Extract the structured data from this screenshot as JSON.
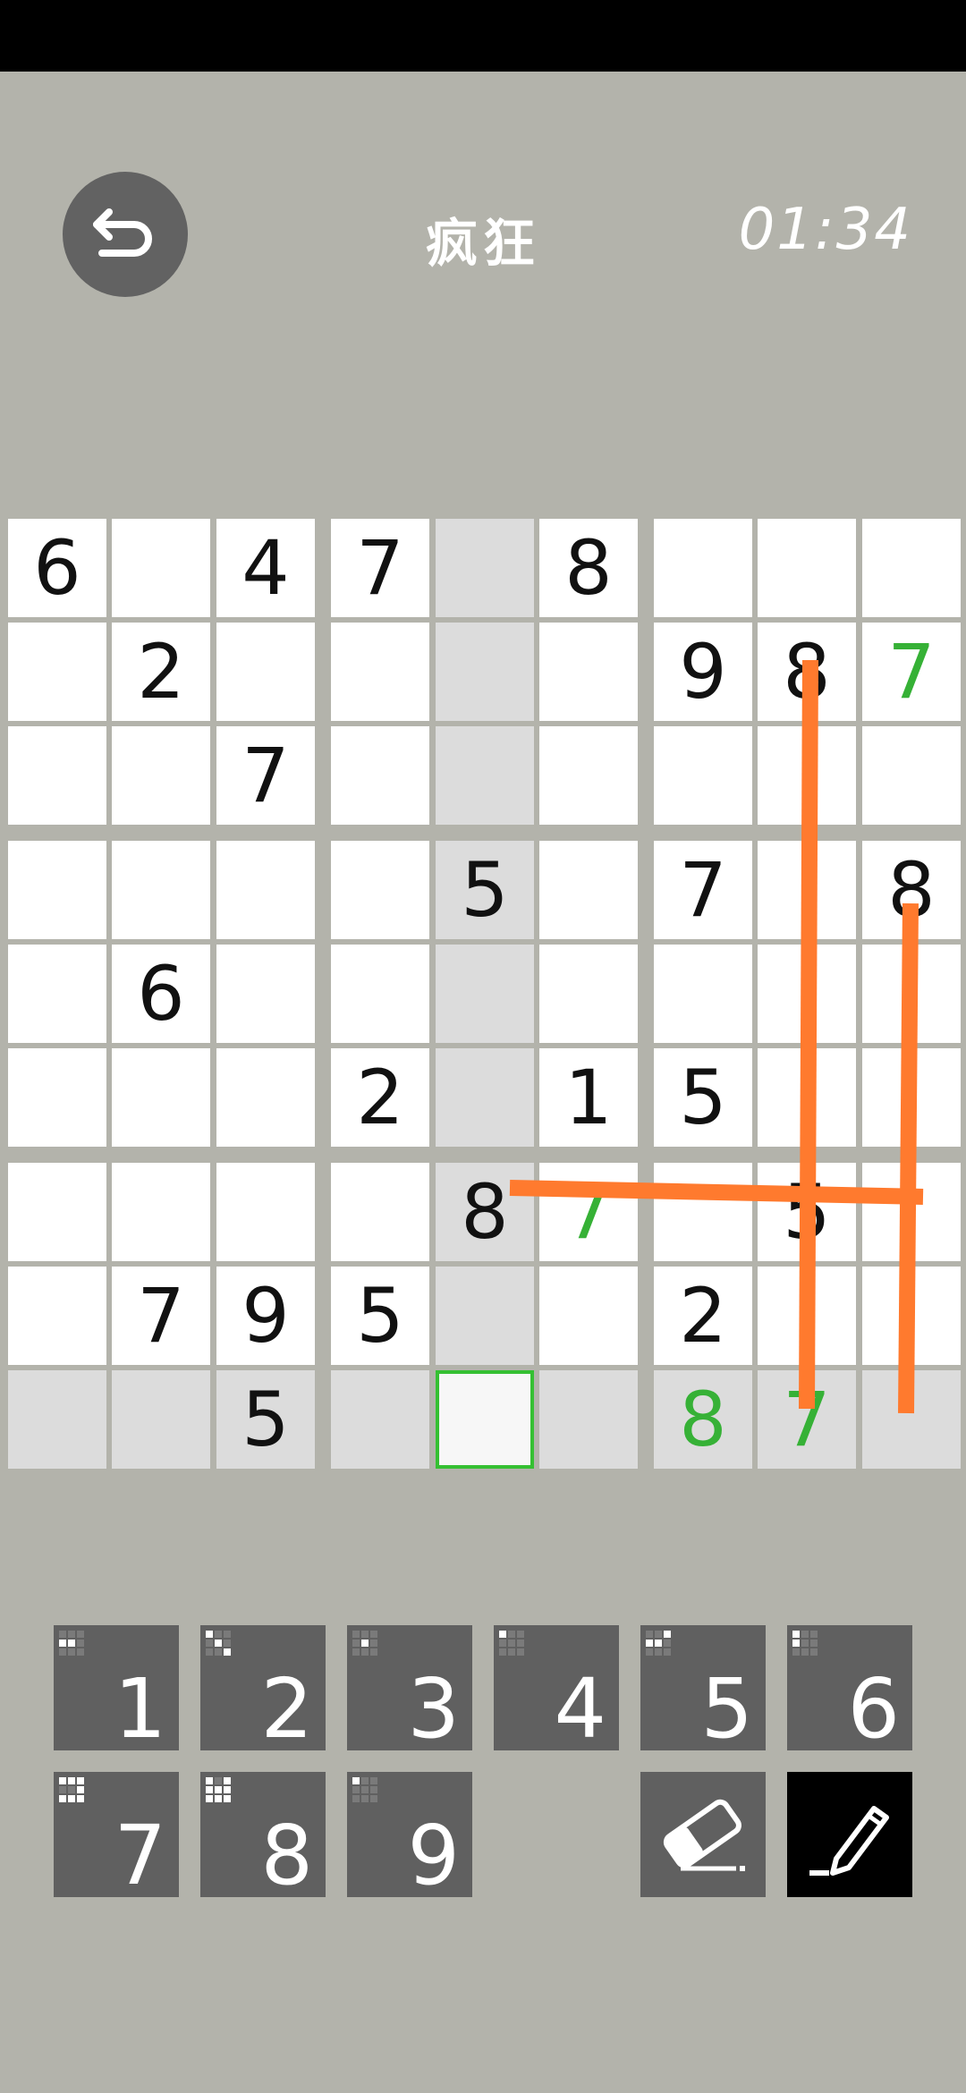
{
  "header": {
    "title": "疯狂",
    "timer": "01:34",
    "back_icon": "undo-arrow-icon"
  },
  "board": {
    "givens": [
      [
        "6",
        "",
        "4",
        "7",
        "",
        "8",
        "",
        "",
        ""
      ],
      [
        "",
        "2",
        "",
        "",
        "",
        "",
        "9",
        "8",
        ""
      ],
      [
        "",
        "",
        "7",
        "",
        "",
        "",
        "",
        "",
        ""
      ],
      [
        "",
        "",
        "",
        "",
        "5",
        "",
        "7",
        "",
        "8"
      ],
      [
        "",
        "6",
        "",
        "",
        "",
        "",
        "",
        "",
        ""
      ],
      [
        "",
        "",
        "",
        "2",
        "",
        "1",
        "5",
        "",
        ""
      ],
      [
        "",
        "",
        "",
        "",
        "8",
        "",
        "",
        "5",
        ""
      ],
      [
        "",
        "7",
        "9",
        "5",
        "",
        "",
        "2",
        "",
        ""
      ],
      [
        "",
        "",
        "5",
        "",
        "",
        "",
        "",
        "",
        ""
      ]
    ],
    "entries": [
      [
        "",
        "",
        "",
        "",
        "",
        "",
        "",
        "",
        ""
      ],
      [
        "",
        "",
        "",
        "",
        "",
        "",
        "",
        "",
        "7"
      ],
      [
        "",
        "",
        "",
        "",
        "",
        "",
        "",
        "",
        ""
      ],
      [
        "",
        "",
        "",
        "",
        "",
        "",
        "",
        "",
        ""
      ],
      [
        "",
        "",
        "",
        "",
        "",
        "",
        "",
        "",
        ""
      ],
      [
        "",
        "",
        "",
        "",
        "",
        "",
        "",
        "",
        ""
      ],
      [
        "",
        "",
        "",
        "",
        "",
        "7",
        "",
        "",
        ""
      ],
      [
        "",
        "",
        "",
        "",
        "",
        "",
        "",
        "",
        ""
      ],
      [
        "",
        "",
        "",
        "",
        "",
        "",
        "8",
        "7",
        ""
      ]
    ],
    "highlight_row": 8,
    "highlight_col": 4,
    "selected": [
      8,
      4
    ],
    "entry_color": "#36b136",
    "highlight_color": "#dcdcdc",
    "stroke_color": "#ff7a2e"
  },
  "keypad": {
    "keys": [
      {
        "label": "1",
        "pattern": [
          0,
          0,
          0,
          1,
          1,
          0,
          0,
          0,
          0
        ]
      },
      {
        "label": "2",
        "pattern": [
          1,
          0,
          0,
          0,
          1,
          0,
          0,
          0,
          1
        ]
      },
      {
        "label": "3",
        "pattern": [
          0,
          0,
          0,
          0,
          1,
          0,
          0,
          0,
          0
        ]
      },
      {
        "label": "4",
        "pattern": [
          1,
          0,
          0,
          0,
          0,
          0,
          0,
          0,
          0
        ]
      },
      {
        "label": "5",
        "pattern": [
          0,
          0,
          1,
          1,
          1,
          0,
          0,
          0,
          0
        ]
      },
      {
        "label": "6",
        "pattern": [
          1,
          0,
          0,
          1,
          0,
          0,
          0,
          0,
          0
        ]
      },
      {
        "label": "7",
        "pattern": [
          1,
          1,
          1,
          0,
          0,
          1,
          1,
          1,
          1
        ]
      },
      {
        "label": "8",
        "pattern": [
          1,
          0,
          1,
          1,
          1,
          1,
          1,
          1,
          1
        ]
      },
      {
        "label": "9",
        "pattern": [
          1,
          0,
          0,
          0,
          0,
          0,
          0,
          0,
          0
        ]
      }
    ],
    "eraser_icon": "eraser-icon",
    "pencil_icon": "pencil-icon",
    "pencil_active_bg": "#000000"
  }
}
